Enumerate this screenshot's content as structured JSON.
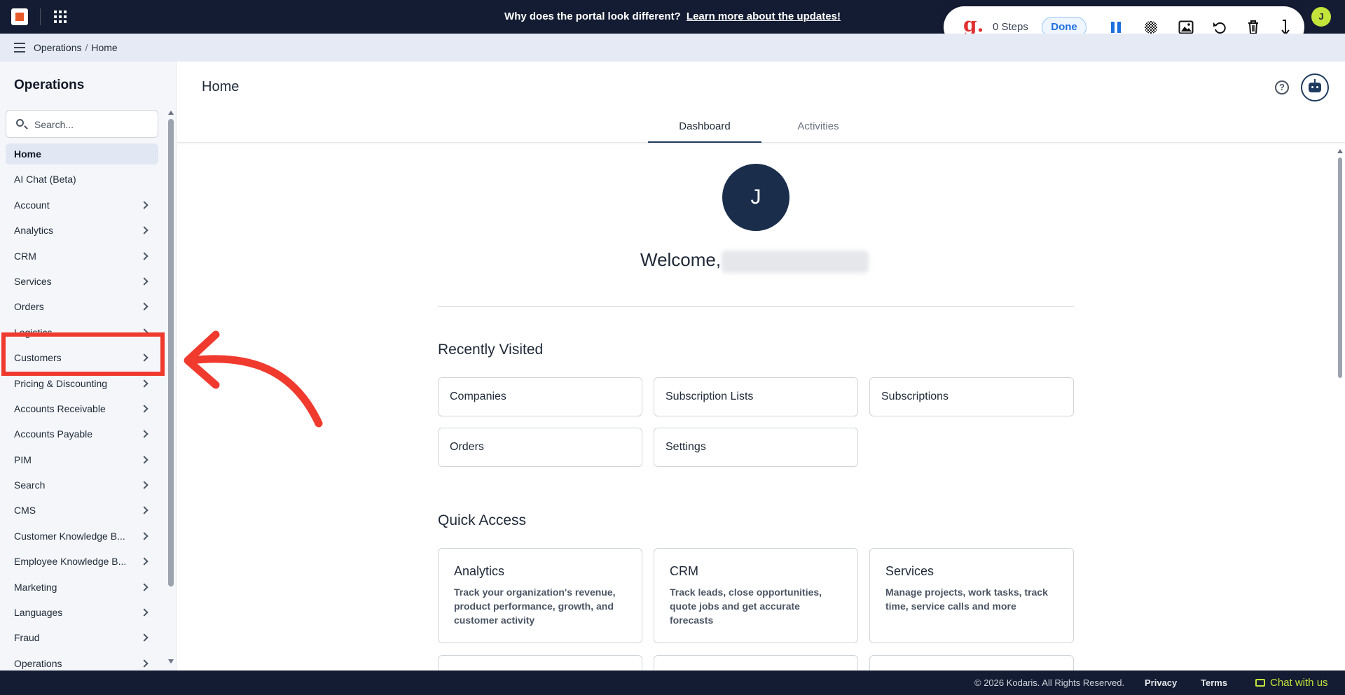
{
  "topbar": {
    "banner_question": "Why does the portal look different?",
    "banner_link": "Learn more about the updates!",
    "user_initial": "J"
  },
  "recorder": {
    "logo": "g.",
    "steps": "0 Steps",
    "done_label": "Done",
    "icons": [
      "pause-icon",
      "blur-icon",
      "image-icon",
      "undo-icon",
      "trash-icon",
      "download-icon"
    ]
  },
  "breadcrumb": {
    "section": "Operations",
    "separator": "/",
    "page": "Home"
  },
  "sidebar": {
    "title": "Operations",
    "search_placeholder": "Search...",
    "items": [
      {
        "label": "Home",
        "active": true,
        "chevron": false
      },
      {
        "label": "AI Chat (Beta)",
        "chevron": false
      },
      {
        "label": "Account",
        "chevron": true
      },
      {
        "label": "Analytics",
        "chevron": true
      },
      {
        "label": "CRM",
        "chevron": true
      },
      {
        "label": "Services",
        "chevron": true
      },
      {
        "label": "Orders",
        "chevron": true
      },
      {
        "label": "Logistics",
        "chevron": true
      },
      {
        "label": "Customers",
        "chevron": true
      },
      {
        "label": "Pricing & Discounting",
        "chevron": true
      },
      {
        "label": "Accounts Receivable",
        "chevron": true
      },
      {
        "label": "Accounts Payable",
        "chevron": true
      },
      {
        "label": "PIM",
        "chevron": true
      },
      {
        "label": "Search",
        "chevron": true
      },
      {
        "label": "CMS",
        "chevron": true
      },
      {
        "label": "Customer Knowledge B...",
        "chevron": true
      },
      {
        "label": "Employee Knowledge B...",
        "chevron": true
      },
      {
        "label": "Marketing",
        "chevron": true
      },
      {
        "label": "Languages",
        "chevron": true
      },
      {
        "label": "Fraud",
        "chevron": true
      },
      {
        "label": "Operations",
        "chevron": true
      }
    ]
  },
  "main": {
    "title": "Home",
    "tabs": [
      {
        "label": "Dashboard",
        "active": true
      },
      {
        "label": "Activities",
        "active": false
      }
    ],
    "avatar_initial": "J",
    "welcome": "Welcome,",
    "recently_visited": {
      "heading": "Recently Visited",
      "items": [
        "Companies",
        "Subscription Lists",
        "Subscriptions",
        "Orders",
        "Settings"
      ]
    },
    "quick_access": {
      "heading": "Quick Access",
      "cards": [
        {
          "title": "Analytics",
          "desc": "Track your organization's revenue, product performance, growth, and customer activity"
        },
        {
          "title": "CRM",
          "desc": "Track leads, close opportunities, quote jobs and get accurate forecasts"
        },
        {
          "title": "Services",
          "desc": "Manage projects, work tasks, track time, service calls and more"
        }
      ]
    }
  },
  "footer": {
    "copyright": "© 2026 Kodaris. All Rights Reserved.",
    "privacy": "Privacy",
    "terms": "Terms",
    "chat": "Chat with us"
  },
  "colors": {
    "topbar_bg": "#141c33",
    "accent": "#1f3a5f",
    "annotation_red": "#f03a2e",
    "chat_green": "#c4e33b"
  }
}
